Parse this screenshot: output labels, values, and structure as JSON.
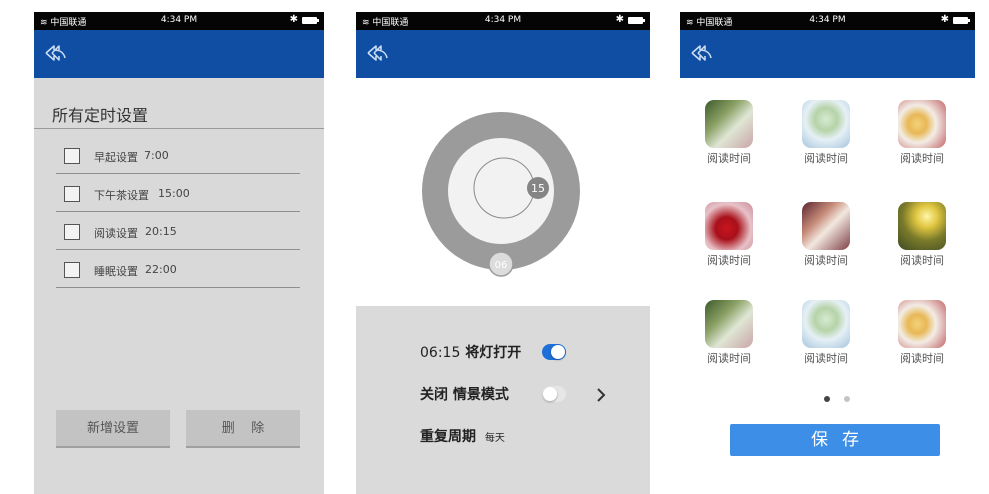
{
  "status_bar": {
    "carrier": "中国联通",
    "time": "4:34 PM"
  },
  "screen1": {
    "title": "所有定时设置",
    "timers": [
      {
        "label": "早起设置",
        "time": "7:00"
      },
      {
        "label": "下午茶设置",
        "time": "15:00"
      },
      {
        "label": "阅读设置",
        "time": "20:15"
      },
      {
        "label": "睡眠设置",
        "time": "22:00"
      }
    ],
    "add_button": "新增设置",
    "delete_button": "删    除"
  },
  "screen2": {
    "dial_minute": "15",
    "dial_hour": "06",
    "light_on_time": "06:15",
    "light_on_label": "将灯打开",
    "scene_close": "关闭",
    "scene_label": "情景模式",
    "repeat_label": "重复周期",
    "repeat_value": "每天"
  },
  "screen3": {
    "items": [
      {
        "caption": "阅读时间",
        "icon": "bookshelf-photo"
      },
      {
        "caption": "阅读时间",
        "icon": "dessert-photo"
      },
      {
        "caption": "阅读时间",
        "icon": "cake-plate-photo"
      },
      {
        "caption": "阅读时间",
        "icon": "rose-photo"
      },
      {
        "caption": "阅读时间",
        "icon": "room-photo"
      },
      {
        "caption": "阅读时间",
        "icon": "sunset-photo"
      },
      {
        "caption": "阅读时间",
        "icon": "bookshelf-photo"
      },
      {
        "caption": "阅读时间",
        "icon": "dessert-photo"
      },
      {
        "caption": "阅读时间",
        "icon": "cake-plate-photo"
      }
    ],
    "save_button": "保存",
    "page_count": 2,
    "current_page": 1
  },
  "colors": {
    "nav": "#0f4ea3",
    "accent": "#3d8ee6",
    "toggle_on": "#1e6fd9",
    "toggle_off": "#e6e6e6",
    "dial_gray": "#9b9b9b"
  }
}
